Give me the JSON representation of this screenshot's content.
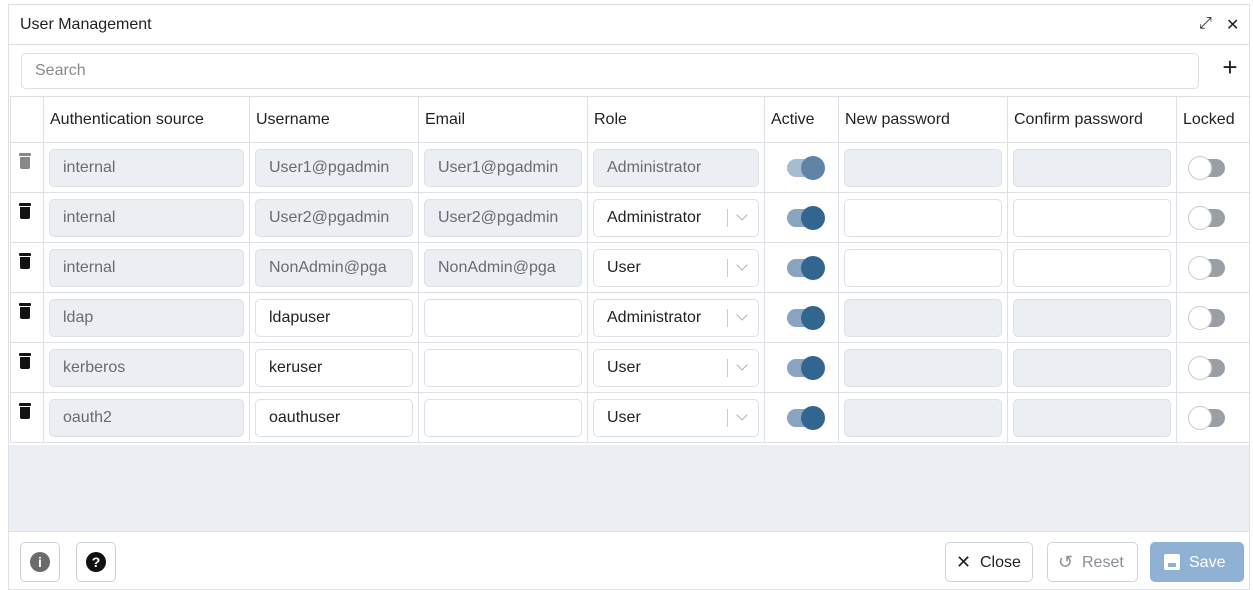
{
  "dialog": {
    "title": "User Management",
    "expand_icon": "expand-arrows-icon",
    "close_icon": "close-x-icon"
  },
  "search": {
    "placeholder": "Search",
    "value": ""
  },
  "columns": [
    "Authentication source",
    "Username",
    "Email",
    "Role",
    "Active",
    "New password",
    "Confirm password",
    "Locked"
  ],
  "rows": [
    {
      "auth_source": "internal",
      "username": "User1@pgadmin",
      "email": "User1@pgadmin",
      "role": "Administrator",
      "active": true,
      "locked": false,
      "editable": false
    },
    {
      "auth_source": "internal",
      "username": "User2@pgadmin",
      "email": "User2@pgadmin",
      "role": "Administrator",
      "active": true,
      "locked": false,
      "editable": true
    },
    {
      "auth_source": "internal",
      "username": "NonAdmin@pga",
      "email": "NonAdmin@pga",
      "role": "User",
      "active": true,
      "locked": false,
      "editable": true
    },
    {
      "auth_source": "ldap",
      "username": "ldapuser",
      "email": "",
      "role": "Administrator",
      "active": true,
      "locked": false,
      "editable": true
    },
    {
      "auth_source": "kerberos",
      "username": "keruser",
      "email": "",
      "role": "User",
      "active": true,
      "locked": false,
      "editable": true
    },
    {
      "auth_source": "oauth2",
      "username": "oauthuser",
      "email": "",
      "role": "User",
      "active": true,
      "locked": false,
      "editable": true
    }
  ],
  "footer": {
    "close_label": "Close",
    "reset_label": "Reset",
    "save_label": "Save",
    "info_glyph": "i",
    "help_glyph": "?"
  },
  "colors": {
    "accent": "#326690",
    "save_bg": "#8fb1d4",
    "disabled_bg": "#ebeef3",
    "border": "#dde0e6"
  }
}
